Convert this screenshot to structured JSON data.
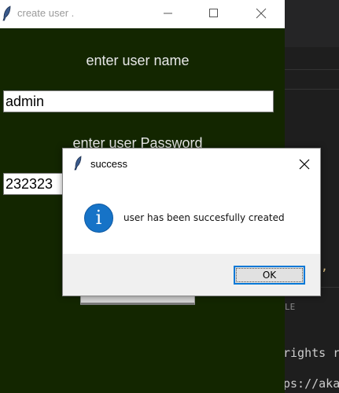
{
  "window": {
    "title": "create user .",
    "username_label": "enter user name",
    "username_value": "admin",
    "password_label": "enter user Password",
    "password_value": "232323"
  },
  "dialog": {
    "title": "success",
    "message": "user has been succesfully created",
    "ok_label": "OK",
    "icon": "info-icon"
  },
  "background": {
    "comma": ",",
    "panel_tag": "LE",
    "line1": "rights r",
    "line2": "ps://aka"
  },
  "colors": {
    "window_bg": "#132600",
    "info_blue": "#1673c7",
    "focus_border": "#0078d7"
  }
}
